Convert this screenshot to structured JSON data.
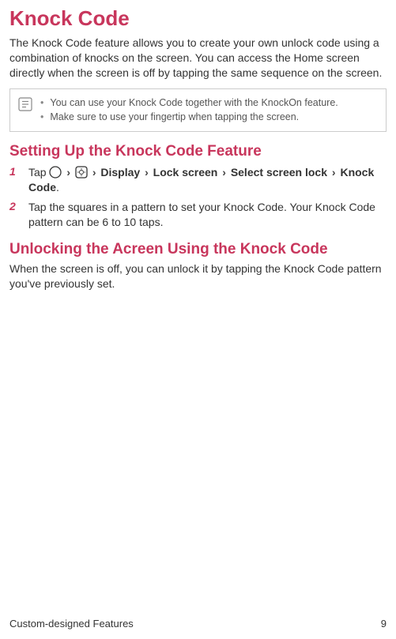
{
  "title": "Knock Code",
  "intro": "The Knock Code feature allows you to create your own unlock code using a combination of knocks on the screen. You can access the Home screen directly when the screen is off by tapping the same sequence on the screen.",
  "notes": [
    "You can use your Knock Code together with the KnockOn feature.",
    "Make sure to use your fingertip when tapping the screen."
  ],
  "section1": {
    "title": "Setting Up the Knock Code Feature",
    "steps": [
      {
        "num": "1",
        "prefix": "Tap ",
        "path": [
          "Display",
          "Lock screen",
          "Select screen lock",
          "Knock Code"
        ],
        "suffix": "."
      },
      {
        "num": "2",
        "text": "Tap the squares in a pattern to set your Knock Code. Your Knock Code pattern can be 6 to 10 taps."
      }
    ]
  },
  "section2": {
    "title": "Unlocking the Acreen Using the Knock Code",
    "text": "When the screen is off, you can unlock it by tapping the Knock Code pattern you've previously set."
  },
  "footer": {
    "label": "Custom-designed Features",
    "page": "9"
  }
}
